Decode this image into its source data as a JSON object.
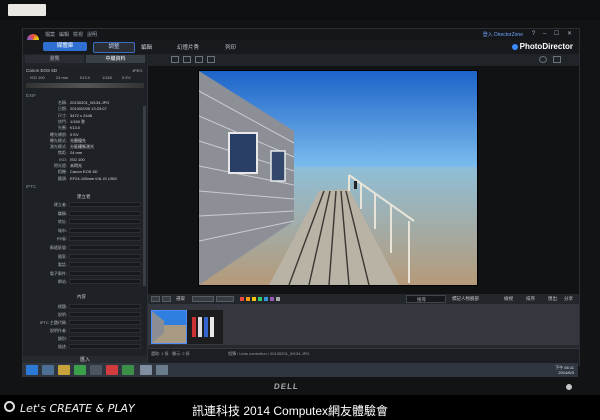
{
  "menu": {
    "items": [
      "檔案",
      "編輯",
      "檢視",
      "說明"
    ],
    "login_link": "登入 DirectorZone",
    "window_controls": "? – ☐ ✕"
  },
  "modes": {
    "library": "媒體庫",
    "adjust": "調整",
    "edit": "編輯",
    "slideshow": "幻燈片秀",
    "print": "列印"
  },
  "brand": "PhotoDirector",
  "subtabs": {
    "tab1": "瀏覽",
    "tab2": "中繼資料"
  },
  "camera": {
    "name": "Canon EOS 6D",
    "stats": [
      "ISO 100",
      "24 mm",
      "f/13.0",
      "1/160",
      "0 EV"
    ],
    "format": "JPEG"
  },
  "exif": {
    "section": "EXIF",
    "rows": [
      {
        "k": "名稱:",
        "v": "20130201_W134.JPG"
      },
      {
        "k": "日期:",
        "v": "2013/02/05 13:23:07"
      },
      {
        "k": "尺寸:",
        "v": "3472 x 2448"
      },
      {
        "k": "快門:",
        "v": "1/160 秒"
      },
      {
        "k": "光圈:",
        "v": "f/13.0"
      },
      {
        "k": "曝光補償:",
        "v": "0 EV"
      },
      {
        "k": "曝光模式:",
        "v": "光圈優先"
      },
      {
        "k": "測光模式:",
        "v": "分區權衡測光"
      },
      {
        "k": "焦距:",
        "v": "24 mm"
      },
      {
        "k": "ISO:",
        "v": "ISO 100"
      },
      {
        "k": "閃光燈:",
        "v": "未閃光"
      },
      {
        "k": "相機:",
        "v": "Canon EOS 6D"
      },
      {
        "k": "鏡頭:",
        "v": "EF24-105mm f/4L IS USM"
      }
    ]
  },
  "iptc": {
    "section": "IPTC",
    "group1_title": "建立者",
    "group1": [
      "建立者:",
      "職稱:",
      "地址:",
      "城市:",
      "州/省:",
      "郵遞區號:",
      "國家:",
      "電話:",
      "電子郵件:",
      "網站:"
    ],
    "group2_title": "內容",
    "group2": [
      "標題:",
      "說明:",
      "IPTC 主題代碼:",
      "說明作者:",
      "類別:",
      "描述:"
    ]
  },
  "import_button": "匯入",
  "viewer_controls": {
    "select_label": "選取",
    "search_placeholder": "搜尋",
    "tag_button": "標記人物臉部",
    "export_label": "匯出",
    "share_label": "分享",
    "view_label": "檢視",
    "sort_label": "排序",
    "swatch_colors": [
      "#e74c3c",
      "#f39c12",
      "#f1c40f",
      "#2ecc71",
      "#3498db",
      "#9b59b6",
      "#aaaaaa"
    ]
  },
  "status": {
    "left": "選取: 1 張 · 顯示: 2 張",
    "path": "相簿 / Lens correction / 20130201_W134.JPG"
  },
  "taskbar": {
    "time": "下午 06:11",
    "date": "2014/6/3"
  },
  "monitor_brand": "DELL",
  "caption": {
    "left": "Let's CREATE & PLAY",
    "right": "訊連科技 2014 Computex網友體驗會"
  }
}
